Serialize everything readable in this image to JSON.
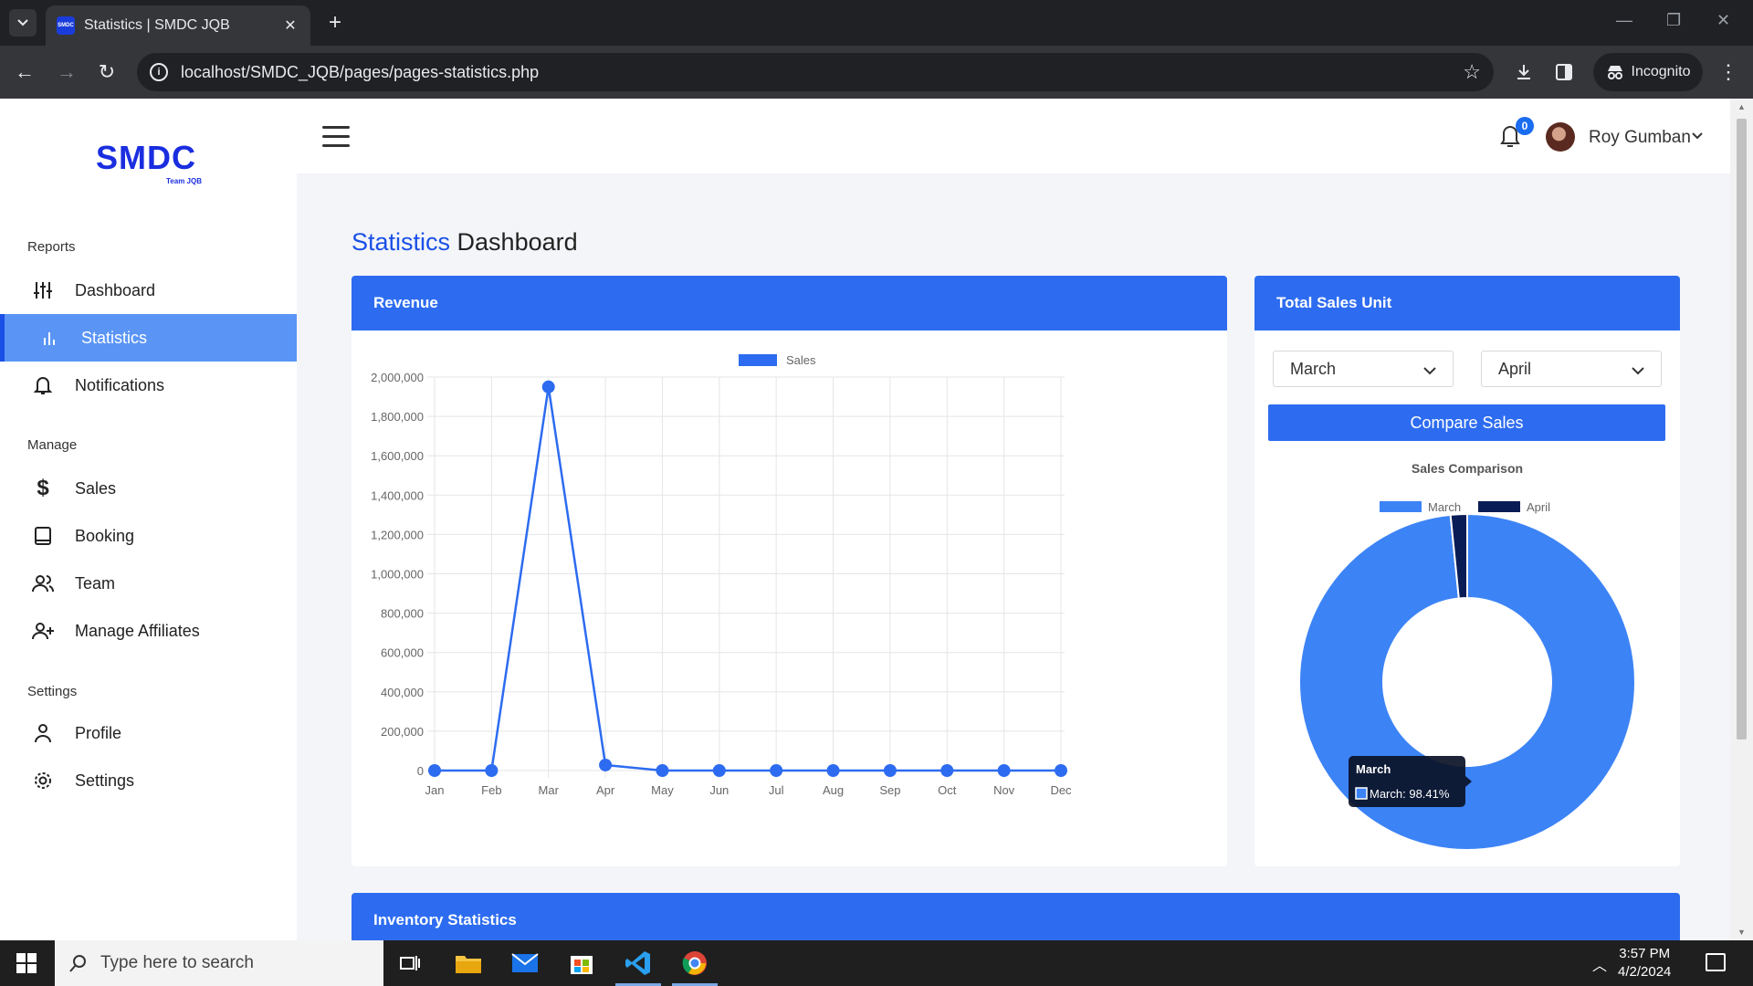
{
  "browser": {
    "tab_title": "Statistics | SMDC JQB",
    "tab_favicon_text": "SMDC",
    "url": "localhost/SMDC_JQB/pages/pages-statistics.php",
    "incognito_label": "Incognito"
  },
  "brand": {
    "name": "SMDC",
    "subtitle": "Team JQB",
    "color": "#1a2ee0"
  },
  "sidebar": {
    "sections": [
      {
        "label": "Reports",
        "items": [
          {
            "label": "Dashboard",
            "icon": "sliders-icon",
            "active": false
          },
          {
            "label": "Statistics",
            "icon": "bar-chart-icon",
            "active": true
          },
          {
            "label": "Notifications",
            "icon": "bell-icon",
            "active": false
          }
        ]
      },
      {
        "label": "Manage",
        "items": [
          {
            "label": "Sales",
            "icon": "dollar-icon",
            "active": false
          },
          {
            "label": "Booking",
            "icon": "book-icon",
            "active": false
          },
          {
            "label": "Team",
            "icon": "users-icon",
            "active": false
          },
          {
            "label": "Manage Affiliates",
            "icon": "user-plus-icon",
            "active": false
          }
        ]
      },
      {
        "label": "Settings",
        "items": [
          {
            "label": "Profile",
            "icon": "user-icon",
            "active": false
          },
          {
            "label": "Settings",
            "icon": "gear-icon",
            "active": false
          }
        ]
      }
    ]
  },
  "header": {
    "notification_count": "0",
    "user_name": "Roy Gumban"
  },
  "main": {
    "title_accent": "Statistics",
    "title_rest": "Dashboard",
    "revenue_card_title": "Revenue",
    "sales_card_title": "Total Sales Unit",
    "select_month_1": "March",
    "select_month_2": "April",
    "compare_button": "Compare Sales",
    "inventory_card_title": "Inventory Statistics"
  },
  "chart_data": [
    {
      "type": "line",
      "title": "",
      "categories": [
        "Jan",
        "Feb",
        "Mar",
        "Apr",
        "May",
        "Jun",
        "Jul",
        "Aug",
        "Sep",
        "Oct",
        "Nov",
        "Dec"
      ],
      "series": [
        {
          "name": "Sales",
          "color": "#2d6cf0",
          "values": [
            0,
            0,
            1950000,
            28000,
            0,
            0,
            0,
            0,
            0,
            0,
            0,
            0
          ]
        }
      ],
      "ylim": [
        0,
        2000000
      ],
      "yticks": [
        "0",
        "200,000",
        "400,000",
        "600,000",
        "800,000",
        "1,000,000",
        "1,200,000",
        "1,400,000",
        "1,600,000",
        "1,800,000",
        "2,000,000"
      ],
      "grid": true,
      "legend": "top"
    },
    {
      "type": "pie",
      "subtype": "doughnut",
      "title": "Sales Comparison",
      "labels": [
        "March",
        "April"
      ],
      "values": [
        98.41,
        1.59
      ],
      "colors": [
        "#3c83f6",
        "#0a1c55"
      ],
      "legend": "top",
      "tooltip": {
        "title": "March",
        "text": "March: 98.41%"
      }
    }
  ],
  "taskbar": {
    "search_placeholder": "Type here to search",
    "time": "3:57 PM",
    "date": "4/2/2024"
  }
}
